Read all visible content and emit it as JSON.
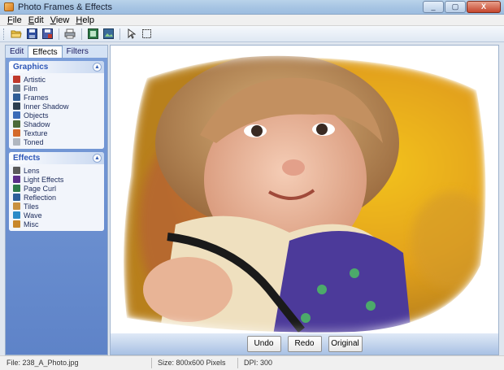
{
  "window": {
    "title": "Photo Frames & Effects",
    "minimize": "_",
    "maximize": "▢",
    "close": "X"
  },
  "menu": [
    {
      "accel": "F",
      "rest": "ile"
    },
    {
      "accel": "E",
      "rest": "dit"
    },
    {
      "accel": "V",
      "rest": "iew"
    },
    {
      "accel": "H",
      "rest": "elp"
    }
  ],
  "toolbar": {
    "icons": [
      "open-folder-icon",
      "save-icon",
      "save-as-icon",
      "print-icon",
      "zoom-fit-icon",
      "export-image-icon",
      "pointer-icon",
      "select-rectangle-icon"
    ]
  },
  "tabs": [
    {
      "label": "Edit",
      "active": false
    },
    {
      "label": "Effects",
      "active": true
    },
    {
      "label": "Filters",
      "active": false
    }
  ],
  "groups": {
    "graphics": {
      "title": "Graphics",
      "items": [
        {
          "label": "Artistic",
          "icon": "paintbrush-icon",
          "color": "#c0392b"
        },
        {
          "label": "Film",
          "icon": "film-icon",
          "color": "#6b7a8a"
        },
        {
          "label": "Frames",
          "icon": "frame-icon",
          "color": "#2f5d96"
        },
        {
          "label": "Inner Shadow",
          "icon": "inner-shadow-icon",
          "color": "#2c3e50"
        },
        {
          "label": "Objects",
          "icon": "objects-icon",
          "color": "#3a6ab8"
        },
        {
          "label": "Shadow",
          "icon": "shadow-icon",
          "color": "#4b6a3a"
        },
        {
          "label": "Texture",
          "icon": "texture-icon",
          "color": "#d46a2a"
        },
        {
          "label": "Toned",
          "icon": "toned-icon",
          "color": "#b0b6bf"
        }
      ]
    },
    "effects": {
      "title": "Effects",
      "items": [
        {
          "label": "Lens",
          "icon": "lens-icon",
          "color": "#5a5a5a"
        },
        {
          "label": "Light Effects",
          "icon": "light-effects-icon",
          "color": "#5b2d8a"
        },
        {
          "label": "Page Curl",
          "icon": "page-curl-icon",
          "color": "#2e7a4a"
        },
        {
          "label": "Reflection",
          "icon": "reflection-icon",
          "color": "#2d5f9a"
        },
        {
          "label": "Tiles",
          "icon": "tiles-icon",
          "color": "#c89040"
        },
        {
          "label": "Wave",
          "icon": "wave-icon",
          "color": "#2a8ac8"
        },
        {
          "label": "Misc",
          "icon": "misc-icon",
          "color": "#c8872a"
        }
      ]
    }
  },
  "buttons": {
    "undo": "Undo",
    "redo": "Redo",
    "original": "Original"
  },
  "status": {
    "file": "File: 238_A_Photo.jpg",
    "size": "Size: 800x600 Pixels",
    "dpi": "DPI: 300"
  }
}
